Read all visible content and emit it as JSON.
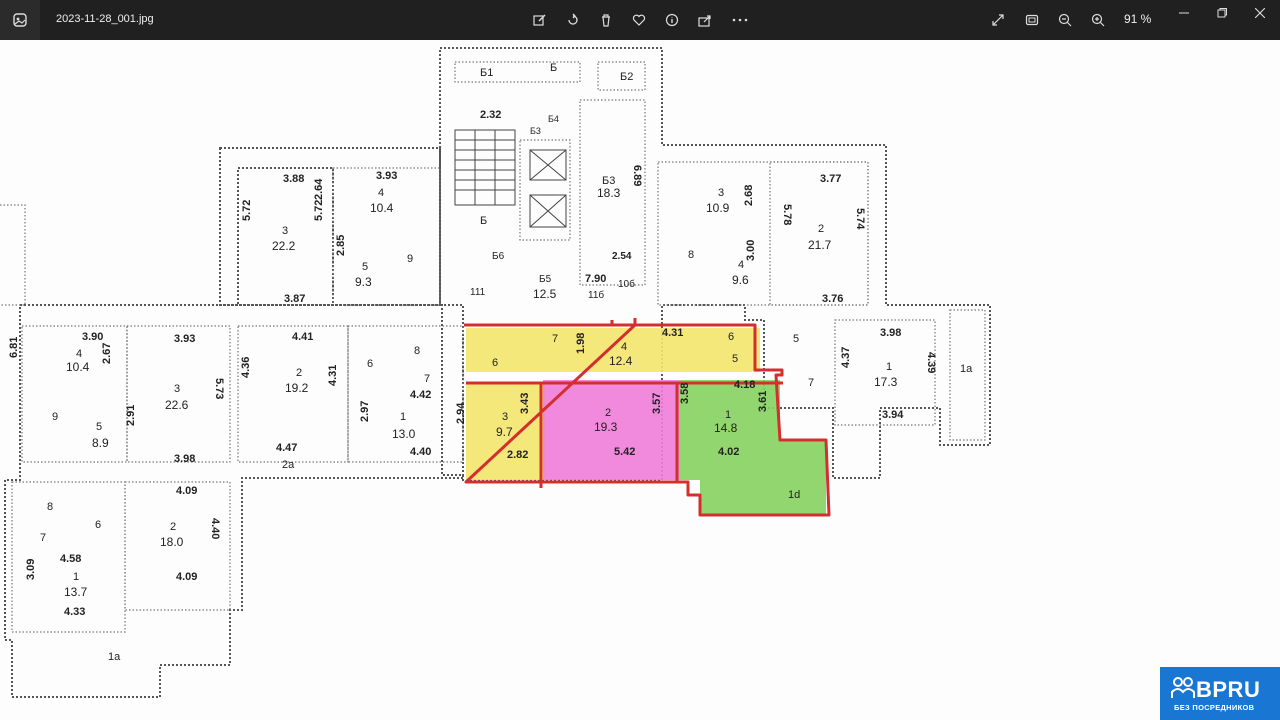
{
  "titlebar": {
    "file_name": "2023-11-28_001.jpg",
    "zoom": "91 %"
  },
  "toolbar": {
    "icons": [
      "edit-icon",
      "rotate-icon",
      "delete-icon",
      "favorite-icon",
      "info-icon",
      "share-icon",
      "more-icon",
      "fullscreen-icon",
      "fit-icon",
      "zoom-out-icon",
      "zoom-in-icon"
    ]
  },
  "window_controls": [
    "minimize-icon",
    "maximize-icon",
    "close-icon"
  ],
  "plan": {
    "top_block": [
      "Б1",
      "Б",
      "Б2",
      "2.32",
      "Б4",
      "Б3",
      "Б",
      "6.89",
      "Б3",
      "18.3",
      "Б6",
      "2.54",
      "Б5",
      "12.5",
      "7.90",
      "11б",
      "10б",
      "111"
    ],
    "left_wing": [
      "3.88",
      "3.93",
      "2.64",
      "4",
      "10.4",
      "5.72",
      "5.72",
      "3",
      "22.2",
      "2.85",
      "5",
      "9.3",
      "9",
      "3.87"
    ],
    "right_wing": [
      "3",
      "10.9",
      "2.68",
      "3.77",
      "5.78",
      "5.74",
      "2",
      "21.7",
      "8",
      "4",
      "9.6",
      "3.00",
      "3.76"
    ],
    "middle_row": [
      "3.90",
      "4",
      "10.4",
      "2.67",
      "3.93",
      "3",
      "22.6",
      "5.73",
      "4.41",
      "4.36",
      "2",
      "19.2",
      "4.31",
      "4.47",
      "2a",
      "6",
      "8",
      "7",
      "4.42",
      "2.97",
      "1",
      "13.0",
      "2.94",
      "4.40",
      "5",
      "8.9",
      "2.91",
      "9",
      "3.98",
      "6.81"
    ],
    "highlighted": [
      "7",
      "1.98",
      "4",
      "12.4",
      "4.31",
      "6",
      "5",
      "6",
      "3",
      "9.7",
      "3.43",
      "2.82",
      "2",
      "19.3",
      "3.57",
      "5.42",
      "3.58",
      "1",
      "14.8",
      "3.61",
      "4.18",
      "4.02",
      "1d"
    ],
    "east_block": [
      "5",
      "7",
      "3.98",
      "4.37",
      "1",
      "17.3",
      "4.39",
      "3.94",
      "1a"
    ],
    "south_block": [
      "8",
      "6",
      "7",
      "4.58",
      "3.09",
      "1",
      "13.7",
      "4.33",
      "1a",
      "4.09",
      "2",
      "18.0",
      "4.40",
      "4.09"
    ]
  },
  "watermark": {
    "brand": "BPRU",
    "tagline": "БЕЗ ПОСРЕДНИКОВ",
    "color": "#1976d2"
  },
  "colors": {
    "titlebar": "#202020",
    "yellow_zone": "#f3e36a",
    "pink_zone": "#f06fd4",
    "green_zone": "#7fd15a",
    "outline": "#d32f2f"
  }
}
